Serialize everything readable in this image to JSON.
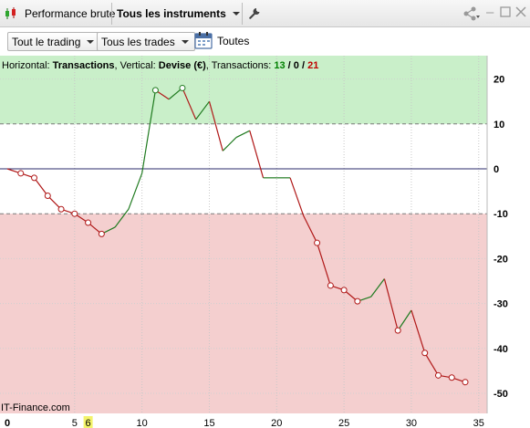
{
  "titlebar": {
    "tab1_label": "Performance brute",
    "tab2_label": "Tous les instruments",
    "icons": [
      "candlestick-icon",
      "wrench-icon",
      "share-icon",
      "minimize-icon",
      "maximize-icon",
      "close-icon"
    ]
  },
  "toolbar": {
    "dropdown1": "Tout le trading",
    "dropdown2": "Tous les trades",
    "toutes_label": "Toutes"
  },
  "header": {
    "horizontal_label": "Horizontal: ",
    "horizontal_value": "Transactions",
    "vertical_label": ", Vertical: ",
    "vertical_value": "Devise (€)",
    "transactions_label": ", Transactions: ",
    "winners": "13",
    "slash1": " / ",
    "neutral": "0",
    "slash2": " / ",
    "losers": "21"
  },
  "watermark": "IT-Finance.com",
  "colors": {
    "green_zone": "#c9efc9",
    "red_zone": "#f4cfcf",
    "up_line": "#1f7a1f",
    "down_line": "#b01818",
    "zero_line": "#2b2b6b",
    "winners": "#008000",
    "losers": "#c00000",
    "highlight_tick": "#f3f36a"
  },
  "chart_data": {
    "type": "line",
    "title": "",
    "xlabel": "",
    "ylabel": "",
    "xlim": [
      0,
      36
    ],
    "ylim": [
      -54,
      22
    ],
    "y_ticks": [
      20,
      10,
      0,
      -10,
      -20,
      -30,
      -40,
      -50
    ],
    "x_ticks": [
      0,
      5,
      6,
      10,
      15,
      20,
      25,
      30,
      35
    ],
    "x_tick_labels": [
      "0",
      "5",
      "6",
      "10",
      "15",
      "20",
      "25",
      "30",
      "35"
    ],
    "highlighted_x_tick": 6,
    "zones": {
      "green_above": 10,
      "red_below": -10
    },
    "grid": true,
    "series": [
      {
        "x": [
          0,
          1,
          2,
          3,
          4,
          5,
          6,
          7,
          8,
          9,
          10,
          11,
          12,
          13,
          14,
          15,
          16,
          17,
          18,
          19,
          20,
          21,
          22,
          23,
          24,
          25,
          26,
          27,
          28,
          29,
          30,
          31,
          32,
          33,
          34
        ],
        "values": [
          0,
          -1,
          -2,
          -6,
          -9,
          -10,
          -12,
          -14.5,
          -13,
          -9,
          -1,
          17.5,
          15.5,
          18,
          11,
          15,
          4,
          7,
          8.5,
          -2,
          -2,
          -2,
          -10.5,
          -16.5,
          -26,
          -27,
          -29.5,
          -28.5,
          -24.5,
          -36,
          -31.5,
          -41,
          -46,
          -46.5,
          -47.5
        ],
        "markers": [
          1,
          2,
          3,
          4,
          5,
          6,
          7,
          11,
          13,
          23,
          24,
          25,
          26,
          29,
          31,
          32,
          33,
          34
        ]
      }
    ]
  }
}
